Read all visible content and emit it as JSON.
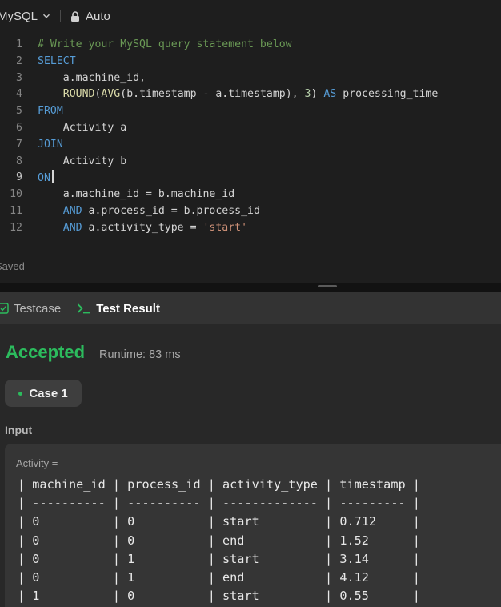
{
  "editor": {
    "language": "MySQL",
    "mode": "Auto",
    "status": "Saved",
    "lines": [
      {
        "n": "1",
        "tokens": [
          {
            "t": "# Write your MySQL query statement below",
            "c": "comment"
          }
        ]
      },
      {
        "n": "2",
        "tokens": [
          {
            "t": "SELECT",
            "c": "kw"
          }
        ]
      },
      {
        "n": "3",
        "guide": true,
        "tokens": [
          {
            "t": "    a.machine_id,",
            "c": "id"
          }
        ]
      },
      {
        "n": "4",
        "guide": true,
        "tokens": [
          {
            "t": "    ",
            "c": "id"
          },
          {
            "t": "ROUND",
            "c": "fn"
          },
          {
            "t": "(",
            "c": "op"
          },
          {
            "t": "AVG",
            "c": "fn"
          },
          {
            "t": "(b.timestamp ",
            "c": "id"
          },
          {
            "t": "-",
            "c": "op"
          },
          {
            "t": " a.timestamp), ",
            "c": "id"
          },
          {
            "t": "3",
            "c": "num"
          },
          {
            "t": ") ",
            "c": "id"
          },
          {
            "t": "AS",
            "c": "kw"
          },
          {
            "t": " processing_time",
            "c": "id"
          }
        ]
      },
      {
        "n": "5",
        "tokens": [
          {
            "t": "FROM",
            "c": "kw"
          }
        ]
      },
      {
        "n": "6",
        "guide": true,
        "tokens": [
          {
            "t": "    Activity a",
            "c": "id"
          }
        ]
      },
      {
        "n": "7",
        "tokens": [
          {
            "t": "JOIN",
            "c": "kw"
          }
        ]
      },
      {
        "n": "8",
        "guide": true,
        "tokens": [
          {
            "t": "    Activity b",
            "c": "id"
          }
        ]
      },
      {
        "n": "9",
        "cursor": true,
        "tokens": [
          {
            "t": "ON",
            "c": "kw"
          }
        ]
      },
      {
        "n": "10",
        "guide": true,
        "tokens": [
          {
            "t": "    a.machine_id ",
            "c": "id"
          },
          {
            "t": "=",
            "c": "op"
          },
          {
            "t": " b.machine_id",
            "c": "id"
          }
        ]
      },
      {
        "n": "11",
        "guide": true,
        "tokens": [
          {
            "t": "    ",
            "c": "id"
          },
          {
            "t": "AND",
            "c": "kw"
          },
          {
            "t": " a.process_id ",
            "c": "id"
          },
          {
            "t": "=",
            "c": "op"
          },
          {
            "t": " b.process_id",
            "c": "id"
          }
        ]
      },
      {
        "n": "12",
        "guide": true,
        "tokens": [
          {
            "t": "    ",
            "c": "id"
          },
          {
            "t": "AND",
            "c": "kw"
          },
          {
            "t": " a.activity_type ",
            "c": "id"
          },
          {
            "t": "=",
            "c": "op"
          },
          {
            "t": " ",
            "c": "id"
          },
          {
            "t": "'start'",
            "c": "str"
          }
        ]
      }
    ]
  },
  "result": {
    "tabs": {
      "testcase": "Testcase",
      "test_result": "Test Result"
    },
    "status": "Accepted",
    "runtime": "Runtime: 83 ms",
    "case_label": "Case 1",
    "input_label": "Input",
    "variable": "Activity =",
    "table_lines": [
      "| machine_id | process_id | activity_type | timestamp |",
      "| ---------- | ---------- | ------------- | --------- |",
      "| 0          | 0          | start         | 0.712     |",
      "| 0          | 0          | end           | 1.52      |",
      "| 0          | 1          | start         | 3.14      |",
      "| 0          | 1          | end           | 4.12      |",
      "| 1          | 0          | start         | 0.55      |"
    ]
  },
  "colors": {
    "accepted": "#2cbb5d",
    "keyword": "#569cd6",
    "function": "#dcdcaa",
    "comment": "#6a9955",
    "string": "#ce9178",
    "number": "#b5cea8"
  },
  "icons": {
    "language_chevron": "chevron-down-icon",
    "mode": "lock-icon",
    "testcase": "checkbox-icon",
    "test_result": "terminal-icon"
  }
}
